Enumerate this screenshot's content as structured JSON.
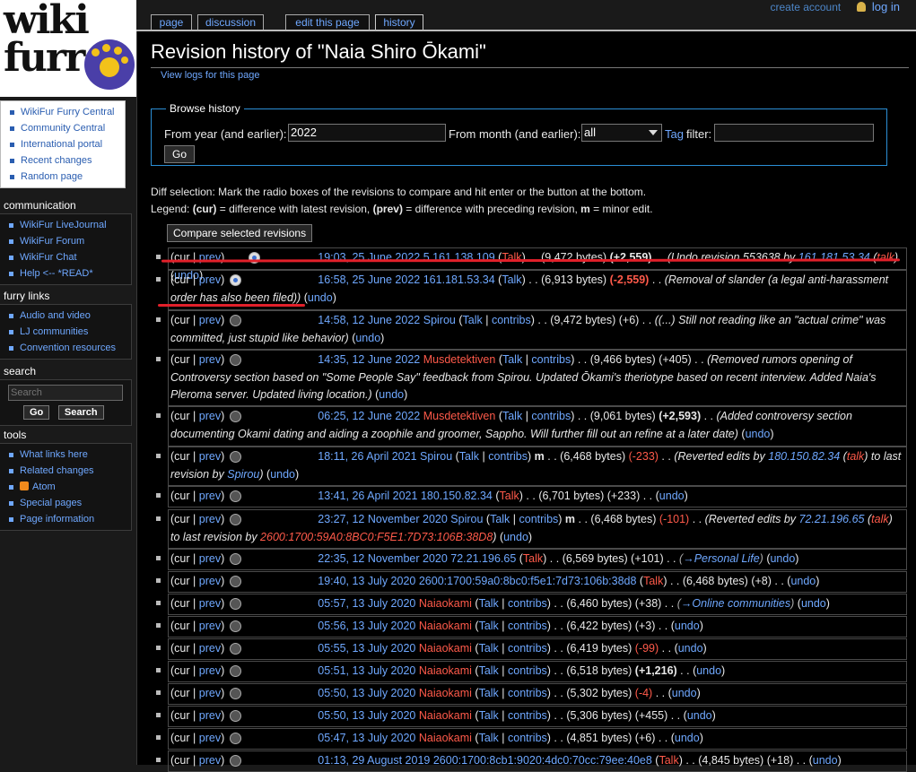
{
  "logo": {
    "line1": "wiki",
    "line2": "furr"
  },
  "personal": {
    "create_account": "create account",
    "login": "log in"
  },
  "tabs": {
    "page": "page",
    "discussion": "discussion",
    "edit": "edit this page",
    "history": "history"
  },
  "sidebar": {
    "nav_items": [
      "WikiFur Furry Central",
      "Community Central",
      "International portal",
      "Recent changes",
      "Random page"
    ],
    "communication": {
      "title": "communication",
      "items": [
        "WikiFur LiveJournal",
        "WikiFur Forum",
        "WikiFur Chat",
        "Help <-- *READ*"
      ]
    },
    "furry_links": {
      "title": "furry links",
      "items": [
        "Audio and video",
        "LJ communities",
        "Convention resources"
      ]
    },
    "search": {
      "title": "search",
      "placeholder": "Search",
      "go": "Go",
      "search_btn": "Search"
    },
    "tools": {
      "title": "tools",
      "items": [
        "What links here",
        "Related changes",
        "Atom",
        "Special pages",
        "Page information"
      ]
    }
  },
  "page": {
    "title": "Revision history of \"Naia Shiro Ōkami\"",
    "view_logs": "View logs for this page",
    "browse": {
      "legend": "Browse history",
      "year_label": "From year (and earlier):",
      "year_value": "2022",
      "month_label": "From month (and earlier):",
      "month_value": "all",
      "tag_link": "Tag",
      "tag_label": "filter:",
      "go": "Go"
    },
    "diff_selection": "Diff selection: Mark the radio boxes of the revisions to compare and hit enter or the button at the bottom.",
    "legend_pre": "Legend: ",
    "legend_cur": "(cur)",
    "legend_mid": " = difference with latest revision, ",
    "legend_prev": "(prev)",
    "legend_mid2": " = difference with preceding revision, ",
    "legend_m": "m",
    "legend_end": " = minor edit.",
    "compare_button": "Compare selected revisions"
  },
  "revisions": [
    {
      "date": "19:03, 25 June 2022",
      "user": "5.161.138.109",
      "user_red": false,
      "ip": true,
      "talk_red": true,
      "size": "(9,472 bytes)",
      "diff": "(+2,559)",
      "diff_kind": "pos",
      "summary": "(Undo revision 553638 by ",
      "summary_link": "161.181.53.34",
      "summary_link2": "talk",
      "summary_end": ")",
      "undo": "undo",
      "radio_left_only": true
    },
    {
      "date": "16:58, 25 June 2022",
      "user": "161.181.53.34",
      "user_red": false,
      "ip": true,
      "talk_red": false,
      "size": "(6,913 bytes)",
      "diff": "(-2,559)",
      "diff_kind": "negbold",
      "summary": "(Removal of slander (a legal anti-harassment order has also been filed))",
      "undo": "undo"
    },
    {
      "date": "14:58, 12 June 2022",
      "user": "Spirou",
      "user_red": false,
      "ip": false,
      "size": "(9,472 bytes)",
      "diff": "(+6)",
      "diff_kind": "plain",
      "summary": "((...) Still not reading like an \"actual crime\" was committed, just stupid like behavior)",
      "undo": "undo"
    },
    {
      "date": "14:35, 12 June 2022",
      "user": "Musdetektiven",
      "user_red": true,
      "ip": false,
      "size": "(9,466 bytes)",
      "diff": "(+405)",
      "diff_kind": "plain",
      "summary": "(Removed rumors opening of Controversy section based on \"Some People Say\" feedback from Spirou. Updated Ōkami's theriotype based on recent interview. Added Naia's Pleroma server. Updated living location.)",
      "undo": "undo"
    },
    {
      "date": "06:25, 12 June 2022",
      "user": "Musdetektiven",
      "user_red": true,
      "ip": false,
      "size": "(9,061 bytes)",
      "diff": "(+2,593)",
      "diff_kind": "pos",
      "summary": "(Added controversy section documenting Okami dating and aiding a zoophile and groomer, Sappho. Will further fill out an refine at a later date)",
      "undo": "undo"
    },
    {
      "date": "18:11, 26 April 2021",
      "user": "Spirou",
      "user_red": false,
      "ip": false,
      "minor": true,
      "size": "(6,468 bytes)",
      "diff": "(-233)",
      "diff_kind": "neg",
      "summary": "(Reverted edits by ",
      "summary_link": "180.150.82.34",
      "summary_link2": "talk",
      "summary_end": ") to last revision by ",
      "summary_link3": "Spirou",
      "summary_end2": ")",
      "undo": "undo"
    },
    {
      "date": "13:41, 26 April 2021",
      "user": "180.150.82.34",
      "user_red": false,
      "ip": true,
      "talk_red": true,
      "size": "(6,701 bytes)",
      "diff": "(+233)",
      "diff_kind": "plain",
      "undo": "undo"
    },
    {
      "date": "23:27, 12 November 2020",
      "user": "Spirou",
      "user_red": false,
      "ip": false,
      "minor": true,
      "size": "(6,468 bytes)",
      "diff": "(-101)",
      "diff_kind": "neg",
      "summary": "(Reverted edits by ",
      "summary_link": "72.21.196.65",
      "summary_link2": "talk",
      "summary_end": ") to last revision by ",
      "summary_link3_red": "2600:1700:59A0:8BC0:F5E1:7D73:106B:38D8",
      "summary_end2": ")",
      "undo": "undo"
    },
    {
      "date": "22:35, 12 November 2020",
      "user": "72.21.196.65",
      "user_red": false,
      "ip": true,
      "talk_red": true,
      "size": "(6,569 bytes)",
      "diff": "(+101)",
      "diff_kind": "plain",
      "arrow_section": "→Personal Life",
      "undo": "undo"
    },
    {
      "date": "19:40, 13 July 2020",
      "user": "2600:1700:59a0:8bc0:f5e1:7d73:106b:38d8",
      "user_red": false,
      "ip": true,
      "talk_red": true,
      "size": "(6,468 bytes)",
      "diff": "(+8)",
      "diff_kind": "plain",
      "undo": "undo"
    },
    {
      "date": "05:57, 13 July 2020",
      "user": "Naiaokami",
      "user_red": true,
      "ip": false,
      "size": "(6,460 bytes)",
      "diff": "(+38)",
      "diff_kind": "plain",
      "arrow_section": "→Online communities",
      "undo": "undo"
    },
    {
      "date": "05:56, 13 July 2020",
      "user": "Naiaokami",
      "user_red": true,
      "ip": false,
      "size": "(6,422 bytes)",
      "diff": "(+3)",
      "diff_kind": "plain",
      "undo": "undo"
    },
    {
      "date": "05:55, 13 July 2020",
      "user": "Naiaokami",
      "user_red": true,
      "ip": false,
      "size": "(6,419 bytes)",
      "diff": "(-99)",
      "diff_kind": "neg",
      "undo": "undo"
    },
    {
      "date": "05:51, 13 July 2020",
      "user": "Naiaokami",
      "user_red": true,
      "ip": false,
      "size": "(6,518 bytes)",
      "diff": "(+1,216)",
      "diff_kind": "pos",
      "undo": "undo"
    },
    {
      "date": "05:50, 13 July 2020",
      "user": "Naiaokami",
      "user_red": true,
      "ip": false,
      "size": "(5,302 bytes)",
      "diff": "(-4)",
      "diff_kind": "neg",
      "undo": "undo"
    },
    {
      "date": "05:50, 13 July 2020",
      "user": "Naiaokami",
      "user_red": true,
      "ip": false,
      "size": "(5,306 bytes)",
      "diff": "(+455)",
      "diff_kind": "plain",
      "undo": "undo"
    },
    {
      "date": "05:47, 13 July 2020",
      "user": "Naiaokami",
      "user_red": true,
      "ip": false,
      "size": "(4,851 bytes)",
      "diff": "(+6)",
      "diff_kind": "plain",
      "undo": "undo"
    },
    {
      "date": "01:13, 29 August 2019",
      "user": "2600:1700:8cb1:9020:4dc0:70cc:79ee:40e8",
      "user_red": false,
      "ip": true,
      "talk_red": true,
      "size": "(4,845 bytes)",
      "diff": "(+18)",
      "diff_kind": "plain",
      "undo": "undo"
    }
  ],
  "labels": {
    "cur": "cur",
    "prev": "prev",
    "talk": "Talk",
    "contribs": "contribs",
    "minor": "m"
  },
  "colors": {
    "link": "#6fa8ff",
    "redlink": "#ff5a4a",
    "annotation_red": "#e2202a"
  }
}
